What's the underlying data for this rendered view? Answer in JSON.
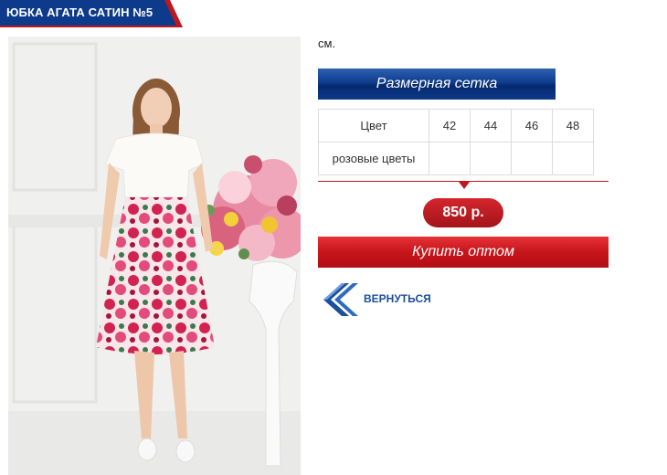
{
  "product": {
    "title": "ЮБКА АГАТА САТИН №5",
    "unit_text": "см."
  },
  "size_grid": {
    "button_label": "Размерная сетка",
    "header_label": "Цвет",
    "sizes": [
      "42",
      "44",
      "46",
      "48"
    ],
    "rows": [
      {
        "color": "розовые цветы",
        "cells": [
          "",
          "",
          "",
          ""
        ]
      }
    ]
  },
  "price": "850 р.",
  "buy_button_label": "Купить оптом",
  "back_link_label": "ВЕРНУТЬСЯ",
  "icons": {
    "back": "double-chevron-left-icon"
  },
  "colors": {
    "title_tab": "#0d3a8a",
    "title_tab_accent": "#c0161d",
    "size_grid_bar": "#0f3d8f",
    "buy_button": "#c8151c",
    "price_badge": "#b5171d",
    "back_link": "#1c4f9c"
  }
}
